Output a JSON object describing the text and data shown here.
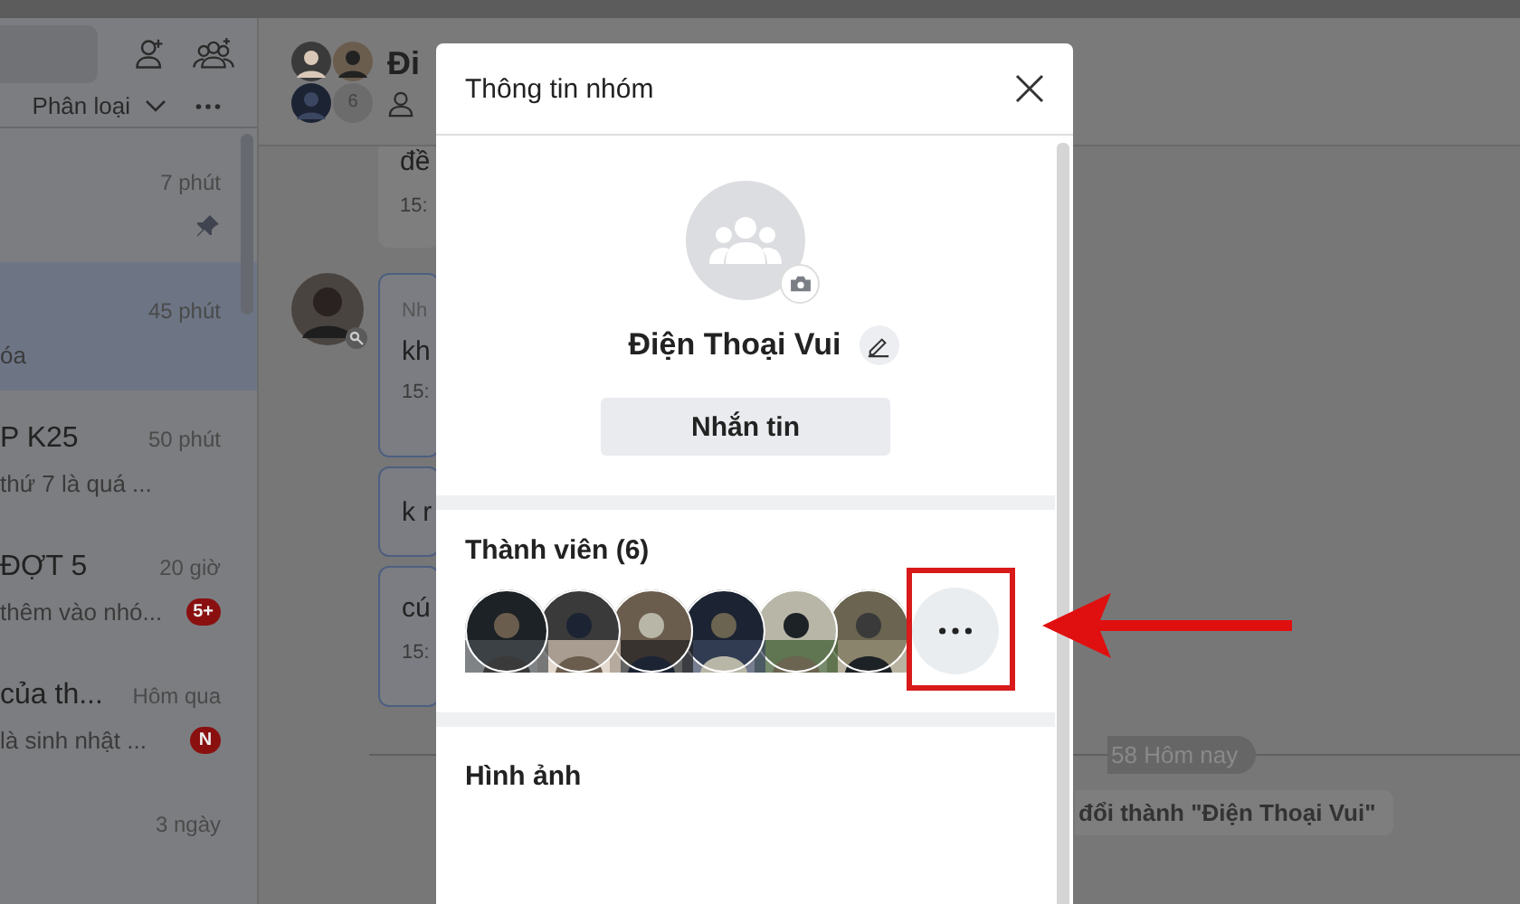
{
  "sidebar": {
    "filter": {
      "label": "Phân loại"
    },
    "conversations": [
      {
        "time": "7 phút",
        "pinned": true,
        "selected": false
      },
      {
        "time": "45 phút",
        "preview": "óa",
        "pinned": false,
        "selected": true
      },
      {
        "title": "P K25",
        "time": "50 phút",
        "preview": "thứ 7 là quá ...",
        "pinned": false,
        "selected": false
      },
      {
        "title": "ĐỢT 5",
        "time": "20 giờ",
        "preview": "thêm vào nhó...",
        "badge": "5+",
        "pinned": false,
        "selected": false
      },
      {
        "title": "của th...",
        "time": "Hôm qua",
        "preview": "là sinh nhật ...",
        "badge": "N",
        "pinned": false,
        "selected": false
      },
      {
        "time": "3 ngày",
        "pinned": false,
        "selected": false
      }
    ]
  },
  "chat": {
    "title": "Đi",
    "member_count": "6",
    "messages": [
      {
        "text": "đề",
        "time": "15:"
      },
      {
        "sender": "Nh",
        "text": "kh",
        "time": "15:",
        "avatar": true
      },
      {
        "text": "k r"
      },
      {
        "text": "cú",
        "time": "15:"
      }
    ],
    "date_divider": "58 Hôm nay",
    "system_message": "đổi thành \"Điện Thoại Vui\""
  },
  "dialog": {
    "title": "Thông tin nhóm",
    "group_name": "Điện Thoại Vui",
    "message_button": "Nhắn tin",
    "members": {
      "title": "Thành viên (6)"
    },
    "media": {
      "title": "Hình ảnh"
    }
  },
  "annotations": {
    "highlight_box": true,
    "arrow": true
  }
}
